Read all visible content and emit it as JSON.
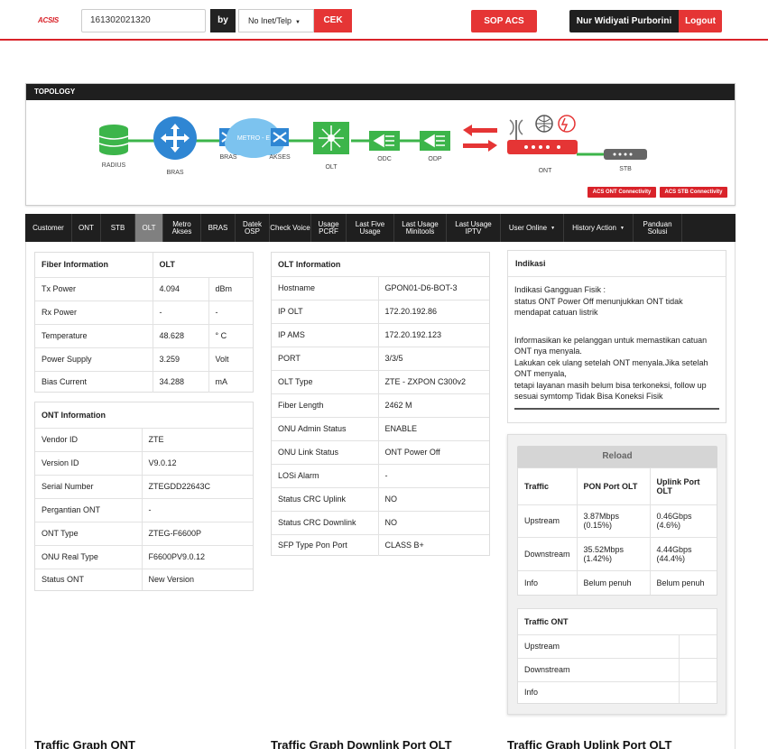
{
  "header": {
    "logo": "ACSIS",
    "search_value": "161302021320",
    "by_label": "by",
    "search_type": "No Inet/Telp",
    "cek_label": "CEK",
    "sop_label": "SOP ACS",
    "user_name": "Nur Widiyati Purborini",
    "logout_label": "Logout"
  },
  "topology": {
    "title": "TOPOLOGY",
    "nodes": {
      "radius": "RADIUS",
      "bras": "BRAS",
      "bras2": "BRAS",
      "metro": "METRO - E",
      "akses": "AKSES",
      "olt": "OLT",
      "odc": "ODC",
      "odp": "ODP",
      "ont": "ONT",
      "stb": "STB"
    },
    "acs_ont": "ACS ONT Connectivity",
    "acs_stb": "ACS STB Connectivity",
    "colors": {
      "green": "#3cb54a",
      "blue": "#2f86d3",
      "red": "#e53535",
      "dark": "#1f1f1f"
    }
  },
  "nav": [
    {
      "label": "Customer"
    },
    {
      "label": "ONT"
    },
    {
      "label": "STB"
    },
    {
      "label": "OLT",
      "active": true
    },
    {
      "label": "Metro Akses"
    },
    {
      "label": "BRAS"
    },
    {
      "label": "Datek OSP"
    },
    {
      "label": "Check Voice"
    },
    {
      "label": "Usage PCRF"
    },
    {
      "label": "Last Five Usage"
    },
    {
      "label": "Last Usage Minitools"
    },
    {
      "label": "Last Usage IPTV"
    },
    {
      "label": "User Online"
    },
    {
      "label": "History Action"
    },
    {
      "label": "Panduan Solusi"
    }
  ],
  "fiber": {
    "header": [
      "Fiber Information",
      "OLT"
    ],
    "rows": [
      [
        "Tx Power",
        "4.094",
        "dBm"
      ],
      [
        "Rx Power",
        "-",
        "-"
      ],
      [
        "Temperature",
        "48.628",
        "° C"
      ],
      [
        "Power Supply",
        "3.259",
        "Volt"
      ],
      [
        "Bias Current",
        "34.288",
        "mA"
      ]
    ]
  },
  "ont_info": {
    "header": "ONT Information",
    "rows": [
      [
        "Vendor ID",
        "ZTE"
      ],
      [
        "Version ID",
        "V9.0.12"
      ],
      [
        "Serial Number",
        "ZTEGDD22643C"
      ],
      [
        "Pergantian ONT",
        "-"
      ],
      [
        "ONT Type",
        "ZTEG-F6600P"
      ],
      [
        "ONU Real Type",
        "F6600PV9.0.12"
      ],
      [
        "Status ONT",
        "New Version"
      ]
    ]
  },
  "olt_info": {
    "header": "OLT Information",
    "rows": [
      [
        "Hostname",
        "GPON01-D6-BOT-3"
      ],
      [
        "IP OLT",
        "172.20.192.86"
      ],
      [
        "IP AMS",
        "172.20.192.123"
      ],
      [
        "PORT",
        "3/3/5"
      ],
      [
        "OLT Type",
        "ZTE - ZXPON C300v2"
      ],
      [
        "Fiber Length",
        "2462 M"
      ],
      [
        "ONU Admin Status",
        "ENABLE"
      ],
      [
        "ONU Link Status",
        "ONT Power Off"
      ],
      [
        "LOSi Alarm",
        "-"
      ],
      [
        "Status CRC Uplink",
        "NO"
      ],
      [
        "Status CRC Downlink",
        "NO"
      ],
      [
        "SFP Type Pon Port",
        "CLASS B+"
      ]
    ]
  },
  "indikasi": {
    "header": "Indikasi",
    "lines1": [
      "Indikasi Gangguan Fisik :",
      "status ONT Power Off menunjukkan ONT tidak mendapat catuan listrik"
    ],
    "lines2": [
      "Informasikan ke pelanggan untuk memastikan catuan ONT nya menyala.",
      "Lakukan cek ulang setelah ONT menyala.Jika setelah ONT menyala,",
      "tetapi layanan masih belum bisa terkoneksi, follow up sesuai symtomp Tidak Bisa Koneksi Fisik"
    ]
  },
  "traffic": {
    "reload_label": "Reload",
    "header": [
      "Traffic",
      "PON Port OLT",
      "Uplink Port OLT"
    ],
    "rows": [
      [
        "Upstream",
        "3.87Mbps (0.15%)",
        "0.46Gbps (4.6%)"
      ],
      [
        "Downstream",
        "35.52Mbps (1.42%)",
        "4.44Gbps (44.4%)"
      ],
      [
        "Info",
        "Belum penuh",
        "Belum penuh"
      ]
    ]
  },
  "traffic_ont": {
    "header": "Traffic ONT",
    "rows": [
      [
        "Upstream",
        ""
      ],
      [
        "Downstream",
        ""
      ],
      [
        "Info",
        ""
      ]
    ]
  },
  "graphs": {
    "ont": "Traffic Graph ONT",
    "downlink": "Traffic Graph Downlink Port OLT",
    "uplink": "Traffic Graph Uplink Port OLT"
  }
}
